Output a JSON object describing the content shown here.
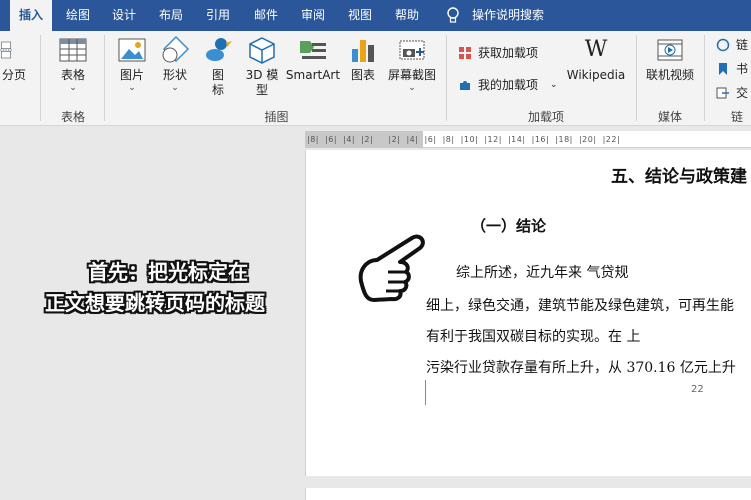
{
  "tabs": [
    {
      "label": "插入",
      "active": true
    },
    {
      "label": "绘图"
    },
    {
      "label": "设计"
    },
    {
      "label": "布局"
    },
    {
      "label": "引用"
    },
    {
      "label": "邮件"
    },
    {
      "label": "审阅"
    },
    {
      "label": "视图"
    },
    {
      "label": "帮助"
    }
  ],
  "tell_me": "操作说明搜索",
  "ribbon": {
    "page_break": "分页",
    "table": "表格",
    "picture": "图片",
    "shapes": "形状",
    "icons": "图\n标",
    "model3d": "3D 模\n型",
    "smartart": "SmartArt",
    "chart": "图表",
    "screenshot": "屏幕截图",
    "get_addins": "获取加载项",
    "my_addins": "我的加载项",
    "wikipedia": "Wikipedia",
    "online_video": "联机视频",
    "link": "链",
    "bookmark": "书",
    "crossref": "交",
    "groups": {
      "tables": "表格",
      "illustrations": "插图",
      "addins": "加载项",
      "media": "媒体",
      "links": "链"
    }
  },
  "ruler_text": "|8|  |6|  |4|  |2|     |2|  |4|  |6|  |8|  |10|  |12|  |14|  |16|  |18|  |20|  |22|",
  "document": {
    "heading1": "五、结论与政策建",
    "heading2": "（一）结论",
    "lines": [
      "综上所述，近九年来        气贷规",
      "细上，绿色交通，建筑节能及绿色建筑，可再生能",
      "有利于我国双碳目标的实现。在         上",
      "污染行业贷款存量有所上升，从 370.16 亿元上升"
    ],
    "page_number": "22"
  },
  "caption": {
    "line1": "首先：把光标定在",
    "line2": "正文想要跳转页码的标题"
  },
  "colors": {
    "ribbon_blue": "#2b579a",
    "ribbon_bg": "#f3f3f3"
  }
}
